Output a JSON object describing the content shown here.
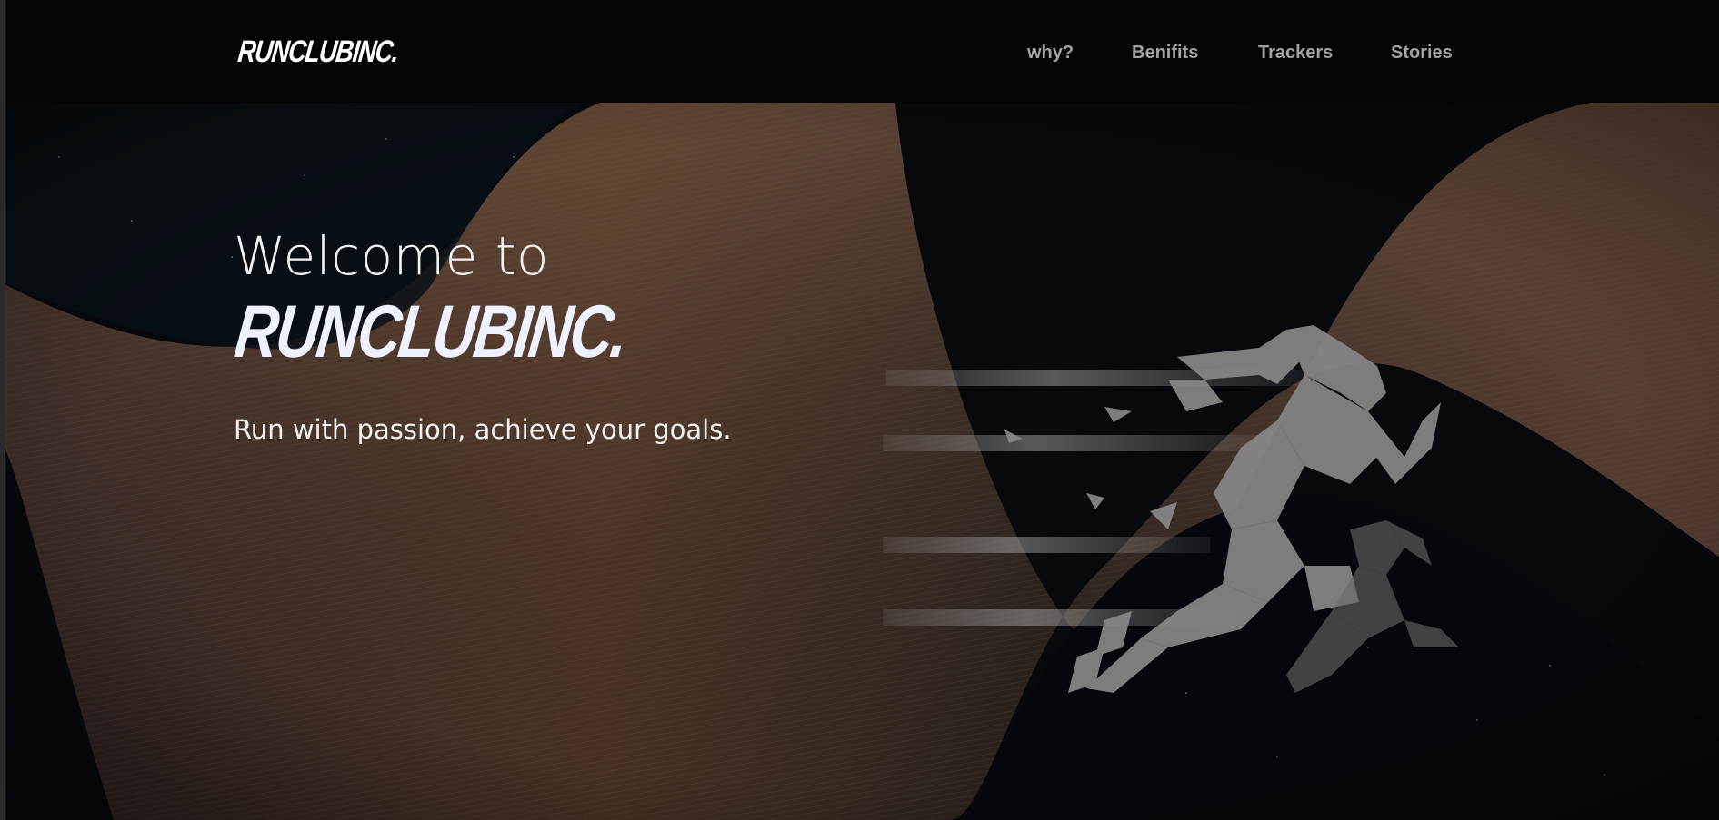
{
  "brand": {
    "logo_text": "RUNCLUBINC."
  },
  "nav": {
    "items": [
      {
        "label": "why?"
      },
      {
        "label": "Benifits"
      },
      {
        "label": "Trackers"
      },
      {
        "label": "Stories"
      }
    ]
  },
  "hero": {
    "welcome_text": "Welcome to",
    "brand_text": "RUNCLUBINC.",
    "tagline": "Run with passion, achieve your goals.",
    "illustration": "sprinting-runner-icon"
  },
  "colors": {
    "nav_bg": "#040404",
    "nav_link": "#a3a3a3",
    "hero_text": "#f2f2f2",
    "wave_accent": "#b4785a"
  }
}
